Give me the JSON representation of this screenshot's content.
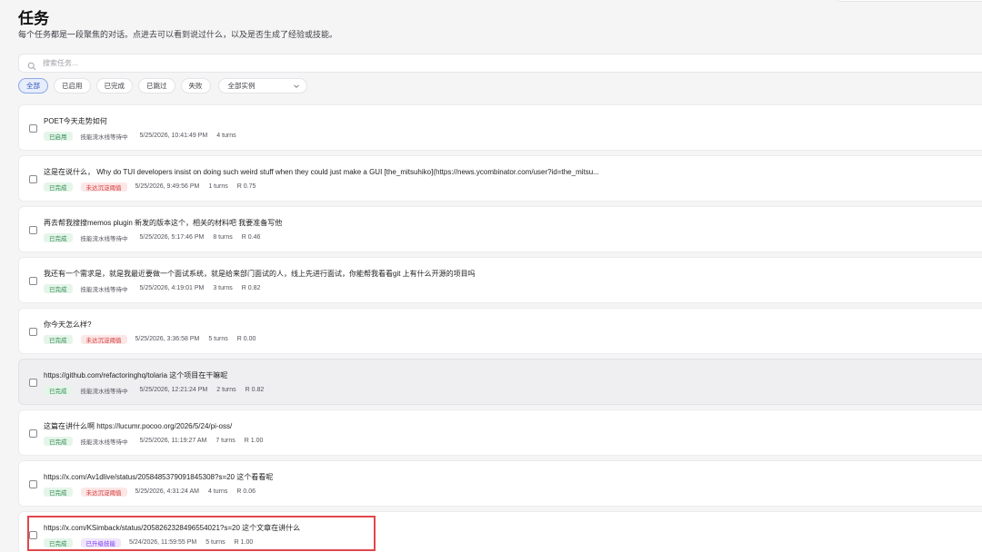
{
  "header": {
    "title": "任务",
    "subtitle": "每个任务都是一段聚焦的对话。点进去可以看到说过什么，以及是否生成了经验或技能。"
  },
  "search": {
    "placeholder": "搜索任务..."
  },
  "filters": {
    "chips": [
      "全部",
      "已启用",
      "已完成",
      "已跳过",
      "失败"
    ],
    "active_index": 0,
    "instance_select": "全部实例"
  },
  "colors": {
    "accent": "#3356b8",
    "status_green": "#2f8a4f",
    "status_red": "#d63b3b",
    "status_purple": "#7c3aed",
    "highlight": "#e0474c"
  },
  "tasks": [
    {
      "title": "POET今天走势如何",
      "status": "已启用",
      "status_color": "green",
      "tag": "技能流水线等待中",
      "tag_color": "plain",
      "time": "5/25/2026, 10:41:49 PM",
      "turns": "4 turns",
      "r": ""
    },
    {
      "title": "这是在说什么， Why do TUI developers insist on doing such weird stuff when they could just make a GUI [the_mitsuhiko](https://news.ycombinator.com/user?id=the_mitsu...",
      "status": "已完成",
      "status_color": "green",
      "tag": "未达沉淀阈值",
      "tag_color": "red",
      "time": "5/25/2026, 9:49:56 PM",
      "turns": "1 turns",
      "r": "R 0.75"
    },
    {
      "title": "再去帮我搜搜memos plugin 新发的版本这个，相关的材料吧 我要准备写他",
      "status": "已完成",
      "status_color": "green",
      "tag": "技能流水线等待中",
      "tag_color": "plain",
      "time": "5/25/2026, 5:17:46 PM",
      "turns": "8 turns",
      "r": "R 0.46"
    },
    {
      "title": "我还有一个需求是，就是我最近要做一个面试系统，就是给来部门面试的人，线上先进行面试，你能帮我看看git 上有什么开源的项目吗",
      "status": "已完成",
      "status_color": "green",
      "tag": "技能流水线等待中",
      "tag_color": "plain",
      "time": "5/25/2026, 4:19:01 PM",
      "turns": "3 turns",
      "r": "R 0.82"
    },
    {
      "title": "你今天怎么样?",
      "status": "已完成",
      "status_color": "green",
      "tag": "未达沉淀阈值",
      "tag_color": "red",
      "time": "5/25/2026, 3:36:58 PM",
      "turns": "5 turns",
      "r": "R 0.00"
    },
    {
      "title": "https://github.com/refactoringhq/tolaria 这个项目在干嘛呢",
      "status": "已完成",
      "status_color": "green",
      "tag": "技能流水线等待中",
      "tag_color": "plain",
      "time": "5/25/2026, 12:21:24 PM",
      "turns": "2 turns",
      "r": "R 0.82"
    },
    {
      "title": "这篇在讲什么啊 https://lucumr.pocoo.org/2026/5/24/pi-oss/",
      "status": "已完成",
      "status_color": "green",
      "tag": "技能流水线等待中",
      "tag_color": "plain",
      "time": "5/25/2026, 11:19:27 AM",
      "turns": "7 turns",
      "r": "R 1.00"
    },
    {
      "title": "https://x.com/Av1dlive/status/2058485379091845308?s=20 这个看看呢",
      "status": "已完成",
      "status_color": "green",
      "tag": "未达沉淀阈值",
      "tag_color": "red",
      "time": "5/25/2026, 4:31:24 AM",
      "turns": "4 turns",
      "r": "R 0.06"
    },
    {
      "title": "https://x.com/KSimback/status/2058262328496554021?s=20 这个文章在讲什么",
      "status": "已完成",
      "status_color": "green",
      "tag": "已升级技能",
      "tag_color": "purple",
      "time": "5/24/2026, 11:59:55 PM",
      "turns": "5 turns",
      "r": "R 1.00"
    }
  ]
}
